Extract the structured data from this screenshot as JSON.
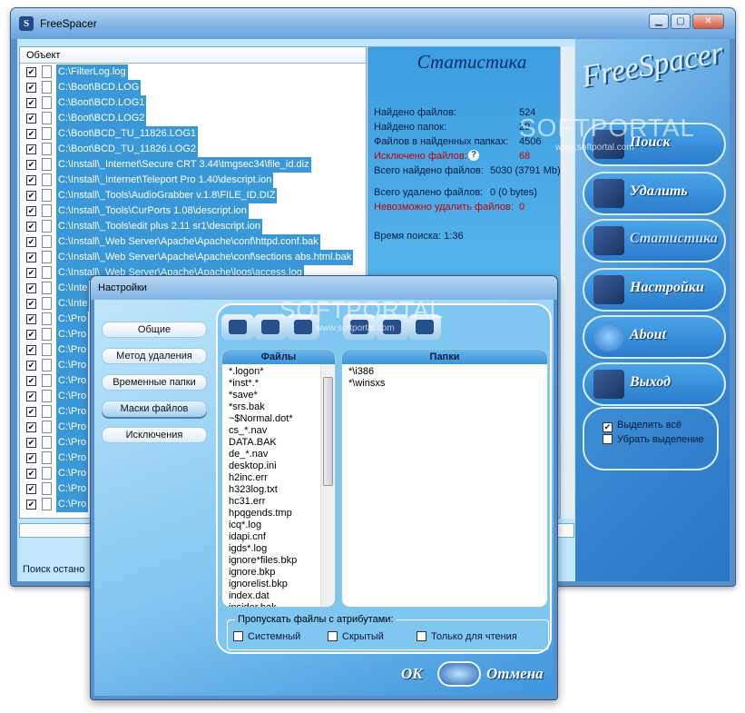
{
  "window": {
    "title": "FreeSpacer"
  },
  "list": {
    "header": "Объект",
    "rows": [
      "C:\\FilterLog.log",
      "C:\\Boot\\BCD.LOG",
      "C:\\Boot\\BCD.LOG1",
      "C:\\Boot\\BCD.LOG2",
      "C:\\Boot\\BCD_TU_11826.LOG1",
      "C:\\Boot\\BCD_TU_11826.LOG2",
      "C:\\Install\\_Internet\\Secure CRT 3.44\\tmgsec34\\file_id.diz",
      "C:\\Install\\_Internet\\Teleport Pro 1.40\\descript.ion",
      "C:\\Install\\_Tools\\AudioGrabber v.1.8\\FILE_ID.DIZ",
      "C:\\Install\\_Tools\\CurPorts 1.08\\descript.ion",
      "C:\\Install\\_Tools\\edit plus 2.11 sr1\\descript.ion",
      "C:\\Install\\_Web Server\\Apache\\Apache\\conf\\httpd.conf.bak",
      "C:\\Install\\_Web Server\\Apache\\Apache\\conf\\sections abs.html.bak",
      "C:\\Install\\_Web Server\\Apache\\Apache\\logs\\access.log",
      "C:\\Inte",
      "C:\\Inte",
      "C:\\Pro",
      "C:\\Pro",
      "C:\\Pro",
      "C:\\Pro",
      "C:\\Pro",
      "C:\\Pro",
      "C:\\Pro",
      "C:\\Pro",
      "C:\\Pro",
      "C:\\Pro",
      "C:\\Pro",
      "C:\\Pro",
      "C:\\Pro"
    ]
  },
  "status": {
    "text": "Поиск остано"
  },
  "stats": {
    "title": "Статистика",
    "found_files_label": "Найдено файлов:",
    "found_files": "524",
    "found_folders_label": "Найдено папок:",
    "found_folders": "29",
    "files_in_folders_label": "Файлов в найденных папках:",
    "files_in_folders": "4506",
    "excluded_label": "Исключено файлов:",
    "excluded": "68",
    "total_label": "Всего найдено файлов:",
    "total": "5030 (3791 Mb)",
    "deleted_label": "Всего удалено файлов:",
    "deleted": "0 (0 bytes)",
    "cannot_delete_label": "Невозможно удалить файлов:",
    "cannot_delete": "0",
    "time_label": "Время поиска: 1:36"
  },
  "sidebar": {
    "logo": "FreeSpacer",
    "buttons": [
      "Поиск",
      "Удалить",
      "Статистика",
      "Настройки",
      "About",
      "Выход"
    ],
    "select_all": "Выделить всё",
    "deselect": "Убрать выделение"
  },
  "watermark": {
    "main": "SOFTPORTAL",
    "sub": "www.softportal.com"
  },
  "dialog": {
    "title": "Настройки",
    "tabs": [
      "Общие",
      "Метод удаления",
      "Временные папки",
      "Маски файлов",
      "Исключения"
    ],
    "files_header": "Файлы",
    "folders_header": "Папки",
    "files": [
      "*.logon*",
      "*inst*.*",
      "*save*",
      "*srs.bak",
      "~$Normal.dot*",
      "cs_*.nav",
      "DATA.BAK",
      "de_*.nav",
      "desktop.ini",
      "h2inc.err",
      "h323log.txt",
      "hc31.err",
      "hpqgends.tmp",
      "icq*.log",
      "idapi.cnf",
      "igds*.log",
      "ignore*files.bkp",
      "ignore.bkp",
      "ignorelist.bkp",
      "index.dat",
      "insider.bak"
    ],
    "folders": [
      "*\\i386",
      "*\\winsxs"
    ],
    "skip_group": "Пропускать файлы с атрибутами:",
    "attr_system": "Системный",
    "attr_hidden": "Скрытый",
    "attr_readonly": "Только для чтения",
    "ok": "OK",
    "cancel": "Отмена"
  }
}
